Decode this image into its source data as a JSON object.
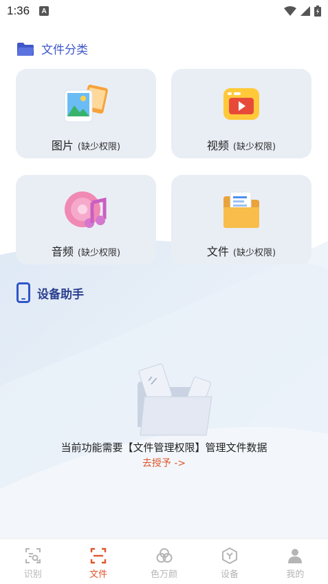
{
  "status": {
    "time": "1:36",
    "notif_icon": "A"
  },
  "sections": {
    "files_title": "文件分类",
    "device_title": "设备助手"
  },
  "cards": [
    {
      "label": "图片",
      "sub": "(缺少权限)",
      "icon": "pictures-icon"
    },
    {
      "label": "视频",
      "sub": "(缺少权限)",
      "icon": "video-icon"
    },
    {
      "label": "音频",
      "sub": "(缺少权限)",
      "icon": "music-icon"
    },
    {
      "label": "文件",
      "sub": "(缺少权限)",
      "icon": "folder-icon"
    }
  ],
  "permission": {
    "message": "当前功能需要【文件管理权限】管理文件数据",
    "link": "去授予 ->"
  },
  "tabs": [
    {
      "label": "识别",
      "icon": "scan-search-icon",
      "active": false
    },
    {
      "label": "文件",
      "icon": "file-scan-icon",
      "active": true
    },
    {
      "label": "色万颜",
      "icon": "color-circles-icon",
      "active": false
    },
    {
      "label": "设备",
      "icon": "device-hex-icon",
      "active": false
    },
    {
      "label": "我的",
      "icon": "profile-icon",
      "active": false
    }
  ],
  "colors": {
    "accent": "#e0562b",
    "primary_blue": "#3f57c9",
    "card_bg": "#e9eef5"
  }
}
